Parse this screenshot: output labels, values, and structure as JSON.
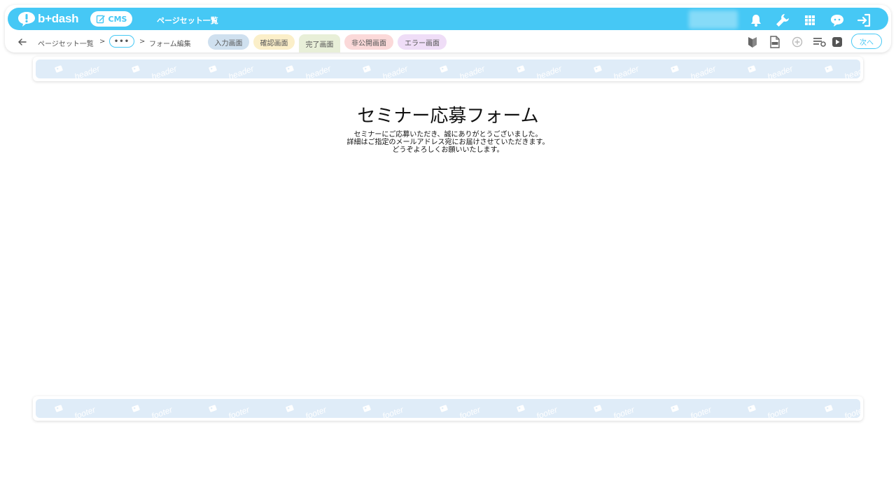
{
  "app": {
    "logo_text": "b+dash",
    "cms_label": "CMS",
    "page_title": "ページセット一覧"
  },
  "topbar_icons": [
    "bell-icon",
    "wrench-icon",
    "grid-icon",
    "support-icon",
    "logout-icon"
  ],
  "breadcrumb": {
    "item1": "ページセット一覧",
    "sep1": ">",
    "dots": "•••",
    "sep2": ">",
    "current": "フォーム編集"
  },
  "tabs": [
    {
      "label": "入力画面",
      "bg": "#cfe0ef"
    },
    {
      "label": "確認画面",
      "bg": "#fbefc9"
    },
    {
      "label": "完了画面",
      "bg": "#e8efd8",
      "active": true
    },
    {
      "label": "非公開画面",
      "bg": "#fbd9d9"
    },
    {
      "label": "エラー画面",
      "bg": "#efddf7"
    }
  ],
  "toolbar": {
    "next_label": "次へ",
    "icons": [
      "beginner-mark-icon",
      "html-file-icon",
      "add-circle-icon",
      "list-settings-icon",
      "play-icon"
    ]
  },
  "header_placeholder": {
    "watermark": "header"
  },
  "footer_placeholder": {
    "watermark": "footer"
  },
  "form": {
    "title": "セミナー応募フォーム",
    "line1": "セミナーにご応募いただき、誠にありがとうございました。",
    "line2": "詳細はご指定のメールアドレス宛にお届けさせていただきます。",
    "line3": "どうぞよろしくお願いいたします。"
  },
  "colors": {
    "accent": "#46c8f5",
    "placeholder_bg": "#dfecf8"
  }
}
